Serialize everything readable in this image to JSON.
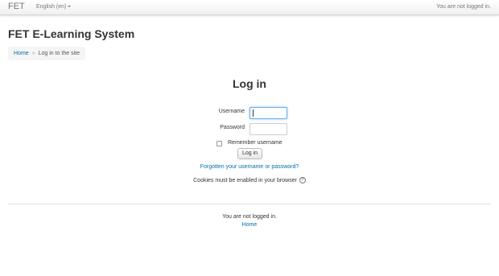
{
  "navbar": {
    "brand": "FET",
    "language": "English (en)",
    "login_status": "You are not logged in."
  },
  "header": {
    "site_title": "FET E-Learning System"
  },
  "breadcrumb": {
    "home": "Home",
    "separator": "»",
    "current": "Log in to the site"
  },
  "login": {
    "heading": "Log in",
    "username_label": "Username",
    "username_value": "",
    "password_label": "Password",
    "password_value": "",
    "remember_label": "Remember username",
    "remember_checked": false,
    "login_button": "Log in",
    "forgot_link": "Forgotten your username or password?",
    "cookies_notice": "Cookies must be enabled in your browser",
    "help_glyph": "?"
  },
  "footer": {
    "login_status": "You are not logged in.",
    "home_link": "Home"
  },
  "colors": {
    "link": "#0070a8",
    "text": "#333333",
    "navbar_text": "#777777",
    "focus": "#66afe9"
  },
  "icons": {
    "language_caret": "chevron-down-icon",
    "help": "help-icon"
  }
}
